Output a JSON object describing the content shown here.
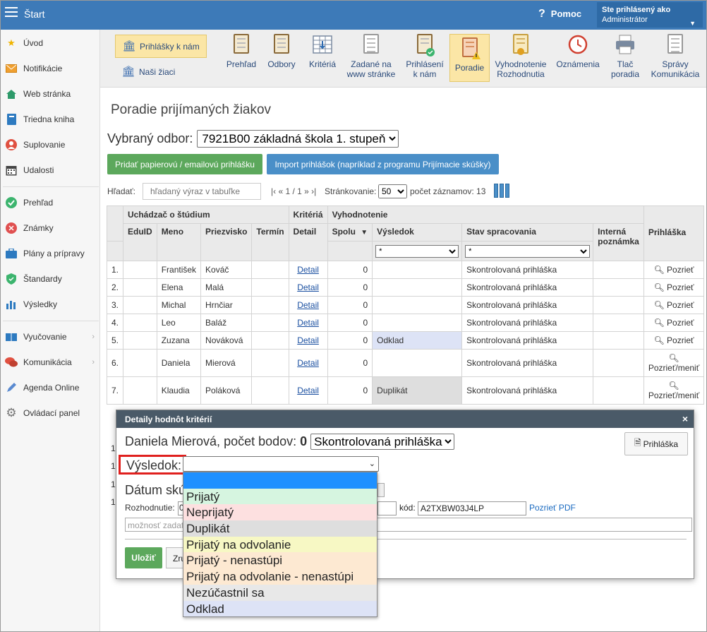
{
  "topbar": {
    "title": "Štart",
    "help": "Pomoc",
    "user_label": "Ste prihlásený ako",
    "user_name": "Administrátor"
  },
  "sidebar": {
    "items": [
      {
        "label": "Úvod",
        "icon": "star-icon"
      },
      {
        "label": "Notifikácie",
        "icon": "envelope-icon"
      },
      {
        "label": "Web stránka",
        "icon": "home-icon"
      },
      {
        "label": "Triedna kniha",
        "icon": "book-icon"
      },
      {
        "label": "Suplovanie",
        "icon": "person-icon"
      },
      {
        "label": "Udalosti",
        "icon": "calendar-icon"
      },
      {
        "label": "Prehľad",
        "icon": "check-circle-icon"
      },
      {
        "label": "Známky",
        "icon": "grade-icon"
      },
      {
        "label": "Plány a prípravy",
        "icon": "briefcase-icon"
      },
      {
        "label": "Štandardy",
        "icon": "shield-icon"
      },
      {
        "label": "Výsledky",
        "icon": "bar-chart-icon"
      },
      {
        "label": "Vyučovanie",
        "icon": "teaching-icon"
      },
      {
        "label": "Komunikácia",
        "icon": "chat-icon"
      },
      {
        "label": "Agenda Online",
        "icon": "pen-icon"
      },
      {
        "label": "Ovládací panel",
        "icon": "gear-icon"
      }
    ]
  },
  "toolbar": {
    "left": [
      {
        "label": "Prihlášky k nám"
      },
      {
        "label": "Naši žiaci"
      }
    ],
    "buttons": [
      {
        "label1": "Prehľad",
        "label2": ""
      },
      {
        "label1": "Odbory",
        "label2": ""
      },
      {
        "label1": "Kritériá",
        "label2": ""
      },
      {
        "label1": "Zadané na",
        "label2": "www stránke"
      },
      {
        "label1": "Prihlásení",
        "label2": "k nám"
      },
      {
        "label1": "Poradie",
        "label2": ""
      },
      {
        "label1": "Vyhodnotenie",
        "label2": "Rozhodnutia"
      },
      {
        "label1": "Oznámenia",
        "label2": ""
      },
      {
        "label1": "Tlač",
        "label2": "poradia"
      },
      {
        "label1": "Správy",
        "label2": "Komunikácia"
      }
    ]
  },
  "page": {
    "title": "Poradie prijímaných žiakov",
    "odbor_label": "Vybraný odbor:",
    "odbor_value": "7921B00 základná škola 1. stupeň",
    "btn_add": "Pridať papierovú / emailovú prihlášku",
    "btn_import": "Import prihlášok (napríklad z programu Prijímacie skúšky)",
    "search_label": "Hľadať:",
    "search_placeholder": "hľadaný výraz v tabuľke",
    "pager": "|‹ « 1 / 1 » ›|",
    "paging_label": "Stránkovanie:",
    "paging_value": "50",
    "count": "počet záznamov: 13"
  },
  "table": {
    "group_headers": {
      "applicant": "Uchádzač o štúdium",
      "criteria": "Kritériá",
      "evaluation": "Vyhodnotenie"
    },
    "headers": {
      "eduid": "EduID",
      "meno": "Meno",
      "priezvisko": "Priezvisko",
      "termin": "Termín",
      "detail": "Detail",
      "spolu": "Spolu",
      "sort": "▼",
      "vysledok": "Výsledok",
      "stav": "Stav spracovania",
      "interna": "Interná poznámka",
      "prihlaska": "Prihláška"
    },
    "filter_value": "*",
    "rows": [
      {
        "n": "1.",
        "meno": "František",
        "priezvisko": "Kováč",
        "detail": "Detail",
        "spolu": "0",
        "vysledok": "",
        "stav": "Skontrolovaná prihláška",
        "akcia": "Pozrieť"
      },
      {
        "n": "2.",
        "meno": "Elena",
        "priezvisko": "Malá",
        "detail": "Detail",
        "spolu": "0",
        "vysledok": "",
        "stav": "Skontrolovaná prihláška",
        "akcia": "Pozrieť"
      },
      {
        "n": "3.",
        "meno": "Michal",
        "priezvisko": "Hrnčiar",
        "detail": "Detail",
        "spolu": "0",
        "vysledok": "",
        "stav": "Skontrolovaná prihláška",
        "akcia": "Pozrieť"
      },
      {
        "n": "4.",
        "meno": "Leo",
        "priezvisko": "Baláž",
        "detail": "Detail",
        "spolu": "0",
        "vysledok": "",
        "stav": "Skontrolovaná prihláška",
        "akcia": "Pozrieť"
      },
      {
        "n": "5.",
        "meno": "Zuzana",
        "priezvisko": "Nováková",
        "detail": "Detail",
        "spolu": "0",
        "vysledok": "Odklad",
        "stav": "Skontrolovaná prihláška",
        "akcia": "Pozrieť"
      },
      {
        "n": "6.",
        "meno": "Daniela",
        "priezvisko": "Mierová",
        "detail": "Detail",
        "spolu": "0",
        "vysledok": "",
        "stav": "Skontrolovaná prihláška",
        "akcia": "Pozrieť/meniť"
      },
      {
        "n": "7.",
        "meno": "Klaudia",
        "priezvisko": "Poláková",
        "detail": "Detail",
        "spolu": "0",
        "vysledok": "Duplikát",
        "stav": "Skontrolovaná prihláška",
        "akcia": "Pozrieť/meniť"
      }
    ],
    "hidden_row_prefix": "1"
  },
  "modal": {
    "title": "Detaily hodnôt kritérií",
    "close": "×",
    "person": "Daniela Mierová, počet bodov:",
    "points": "0",
    "status_value": "Skontrolovaná prihláška",
    "prihlaska_btn": "Prihláška",
    "vysledok_label": "Výsledok:",
    "datum_label": "Dátum skú",
    "rozhodnutie_label": "Rozhodnutie:",
    "rozhodnutie_value": "0",
    "kod_label": "kód:",
    "kod_value": "A2TXBW03J4LP",
    "pdf_link": "Pozrieť PDF",
    "note_placeholder": "možnosť zadat",
    "save": "Uložiť",
    "cancel": "Zru"
  },
  "dropdown": {
    "options": [
      {
        "label": "",
        "color": "#1e90ff"
      },
      {
        "label": "Prijatý",
        "color": "#d6f5e0"
      },
      {
        "label": "Neprijatý",
        "color": "#fde0e0"
      },
      {
        "label": "Duplikát",
        "color": "#dedede"
      },
      {
        "label": "Prijatý na odvolanie",
        "color": "#f7f8c4"
      },
      {
        "label": "Prijatý - nenastúpi",
        "color": "#fde9d2"
      },
      {
        "label": "Prijatý na odvolanie - nenastúpi",
        "color": "#fde9d2"
      },
      {
        "label": "Nezúčastnil sa",
        "color": "#e8e8e8"
      },
      {
        "label": "Odklad",
        "color": "#dde3f6"
      }
    ]
  },
  "colors": {
    "topbar": "#3d7ab8",
    "green": "#5ca85c",
    "blue": "#4a8fc8",
    "modal_header": "#4a5a68",
    "highlight": "#e0201e"
  }
}
